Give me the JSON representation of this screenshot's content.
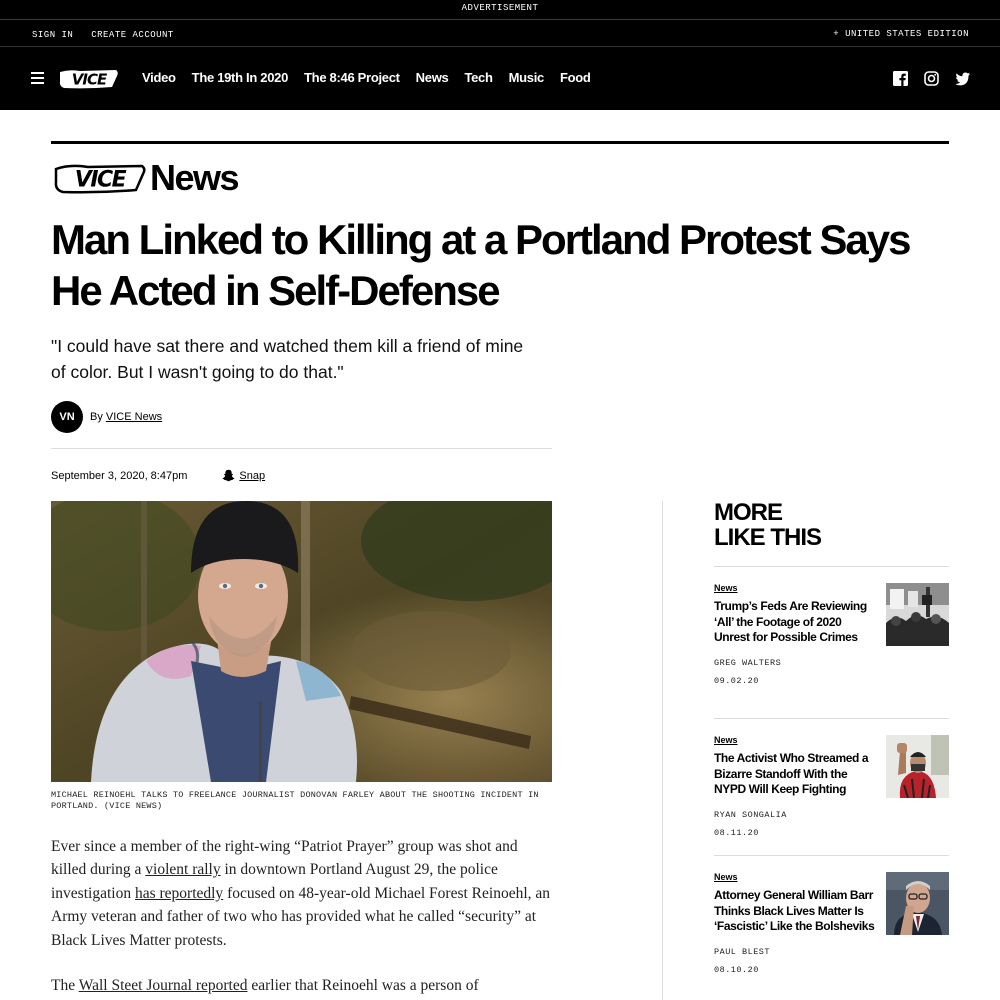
{
  "ad_bar": {
    "label": "ADVERTISEMENT"
  },
  "account_bar": {
    "sign_in": "SIGN IN",
    "create_account": "CREATE ACCOUNT",
    "edition": "+ UNITED STATES EDITION"
  },
  "nav": {
    "logo": "VICE",
    "links": [
      "Video",
      "The 19th In 2020",
      "The 8:46 Project",
      "News",
      "Tech",
      "Music",
      "Food"
    ],
    "social": [
      "facebook-icon",
      "instagram-icon",
      "twitter-icon"
    ]
  },
  "brand": {
    "logo": "VICE",
    "section": "News"
  },
  "article": {
    "headline": "Man Linked to Killing at a Portland Protest Says He Acted in Self-Defense",
    "dek": "\"I could have sat there and watched them kill a friend of mine of color. But I wasn't going to do that.\"",
    "author_initials": "VN",
    "by_prefix": "By",
    "author": "VICE News",
    "date": "September 3, 2020, 8:47pm",
    "share_label": "Snap",
    "caption": "MICHAEL REINOEHL TALKS TO FREELANCE JOURNALIST DONOVAN FARLEY ABOUT THE SHOOTING INCIDENT IN PORTLAND. (VICE NEWS)",
    "p1": {
      "t1": "Ever since a member of the right-wing “Patriot Prayer” group was shot and killed during a ",
      "l1": "violent rally",
      "t2": " in downtown Portland August 29, the police investigation ",
      "l2": "has reportedly",
      "t3": " focused on 48-year-old Michael Forest Reinoehl, an Army veteran and father of two who has provided what he called “security” at Black Lives Matter protests."
    },
    "p2": {
      "t1": "The ",
      "l1": "Wall Steet Journal reported",
      "t2": " earlier that Reinoehl was a person of"
    }
  },
  "sidebar": {
    "title_line1": "MORE",
    "title_line2": "LIKE THIS",
    "cards": [
      {
        "tag": "News",
        "title": "Trump’s Feds Are Reviewing ‘All’ the Footage of 2020 Unrest for Possible Crimes",
        "author": "GREG WALTERS",
        "date": "09.02.20"
      },
      {
        "tag": "News",
        "title": "The Activist Who Streamed a Bizarre Standoff With the NYPD Will Keep Fighting",
        "author": "RYAN SONGALIA",
        "date": "08.11.20"
      },
      {
        "tag": "News",
        "title": "Attorney General William Barr Thinks Black Lives Matter Is ‘Fascistic’ Like the Bolsheviks",
        "author": "PAUL BLEST",
        "date": "08.10.20"
      }
    ]
  }
}
